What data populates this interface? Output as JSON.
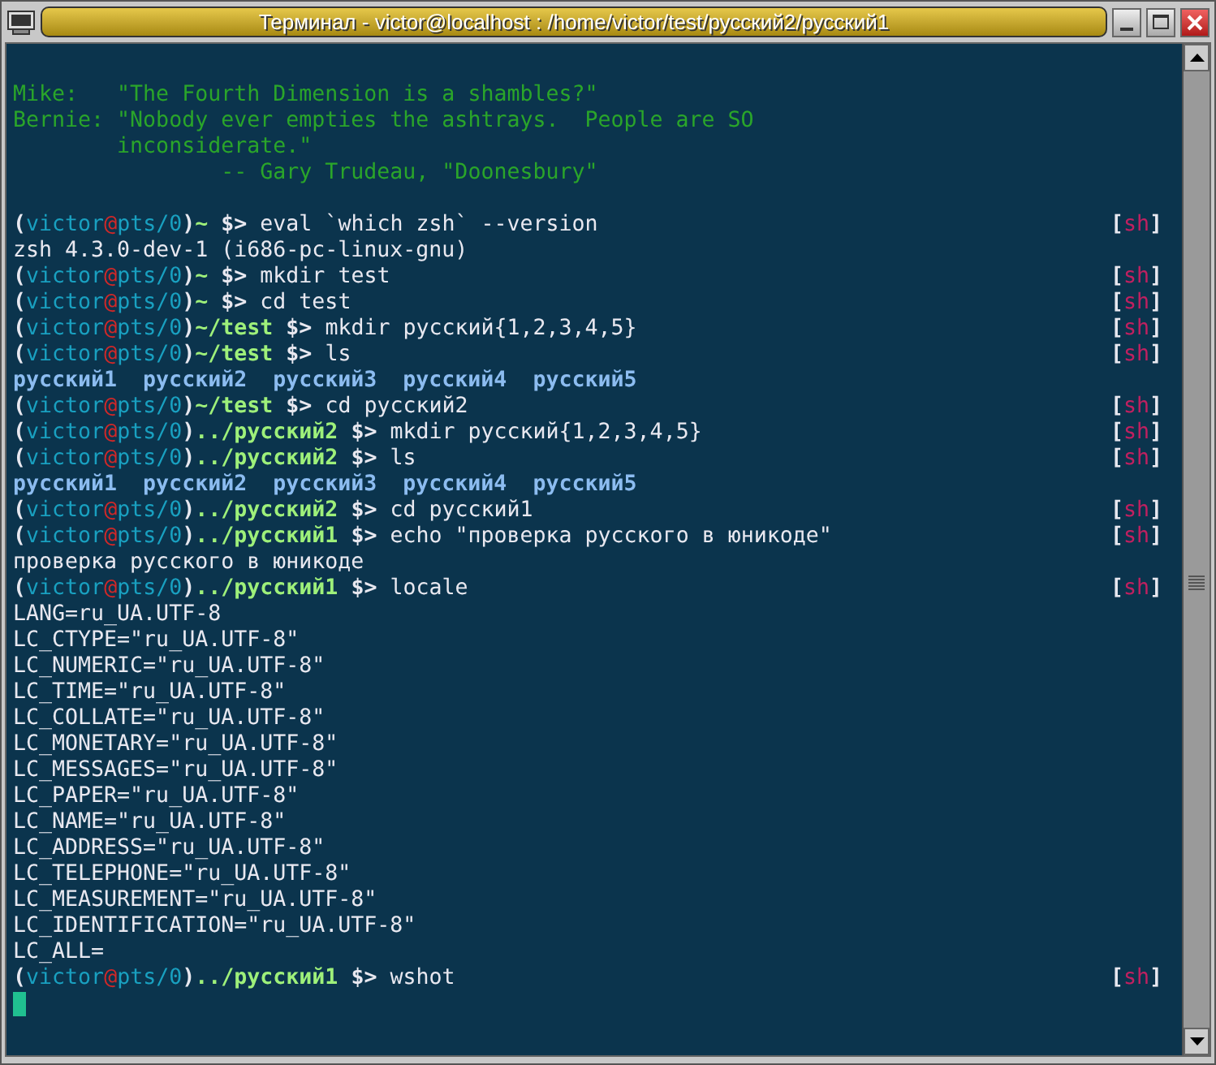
{
  "window": {
    "title": "Терминал - victor@localhost : /home/victor/test/русский2/русский1"
  },
  "lines": [
    {
      "kind": "blank"
    },
    {
      "kind": "quote",
      "text": "Mike:   \"The Fourth Dimension is a shambles?\""
    },
    {
      "kind": "quote",
      "text": "Bernie: \"Nobody ever empties the ashtrays.  People are SO"
    },
    {
      "kind": "quote",
      "text": "        inconsiderate.\""
    },
    {
      "kind": "quote",
      "text": "                -- Gary Trudeau, \"Doonesbury\""
    },
    {
      "kind": "blank"
    },
    {
      "kind": "prompt",
      "open": "(",
      "user": "victor",
      "at": "@",
      "tty": "pts/0",
      "close": ")",
      "path": "~",
      "sigil": "$>",
      "command": "eval `which zsh` --version",
      "tag": {
        "open": "[",
        "name": "sh",
        "close": "]"
      }
    },
    {
      "kind": "output",
      "text": "zsh 4.3.0-dev-1 (i686-pc-linux-gnu)"
    },
    {
      "kind": "prompt",
      "open": "(",
      "user": "victor",
      "at": "@",
      "tty": "pts/0",
      "close": ")",
      "path": "~",
      "sigil": "$>",
      "command": "mkdir test",
      "tag": {
        "open": "[",
        "name": "sh",
        "close": "]"
      }
    },
    {
      "kind": "prompt",
      "open": "(",
      "user": "victor",
      "at": "@",
      "tty": "pts/0",
      "close": ")",
      "path": "~",
      "sigil": "$>",
      "command": "cd test",
      "tag": {
        "open": "[",
        "name": "sh",
        "close": "]"
      }
    },
    {
      "kind": "prompt",
      "open": "(",
      "user": "victor",
      "at": "@",
      "tty": "pts/0",
      "close": ")",
      "path": "~/test",
      "sigil": "$>",
      "command": "mkdir русский{1,2,3,4,5}",
      "tag": {
        "open": "[",
        "name": "sh",
        "close": "]"
      }
    },
    {
      "kind": "prompt",
      "open": "(",
      "user": "victor",
      "at": "@",
      "tty": "pts/0",
      "close": ")",
      "path": "~/test",
      "sigil": "$>",
      "command": "ls",
      "tag": {
        "open": "[",
        "name": "sh",
        "close": "]"
      }
    },
    {
      "kind": "listing",
      "items": [
        "русский1",
        "русский2",
        "русский3",
        "русский4",
        "русский5"
      ]
    },
    {
      "kind": "prompt",
      "open": "(",
      "user": "victor",
      "at": "@",
      "tty": "pts/0",
      "close": ")",
      "path": "~/test",
      "sigil": "$>",
      "command": "cd русский2",
      "tag": {
        "open": "[",
        "name": "sh",
        "close": "]"
      }
    },
    {
      "kind": "prompt",
      "open": "(",
      "user": "victor",
      "at": "@",
      "tty": "pts/0",
      "close": ")",
      "path": "../русский2",
      "sigil": "$>",
      "command": "mkdir русский{1,2,3,4,5}",
      "tag": {
        "open": "[",
        "name": "sh",
        "close": "]"
      }
    },
    {
      "kind": "prompt",
      "open": "(",
      "user": "victor",
      "at": "@",
      "tty": "pts/0",
      "close": ")",
      "path": "../русский2",
      "sigil": "$>",
      "command": "ls",
      "tag": {
        "open": "[",
        "name": "sh",
        "close": "]"
      }
    },
    {
      "kind": "listing",
      "items": [
        "русский1",
        "русский2",
        "русский3",
        "русский4",
        "русский5"
      ]
    },
    {
      "kind": "prompt",
      "open": "(",
      "user": "victor",
      "at": "@",
      "tty": "pts/0",
      "close": ")",
      "path": "../русский2",
      "sigil": "$>",
      "command": "cd русский1",
      "tag": {
        "open": "[",
        "name": "sh",
        "close": "]"
      }
    },
    {
      "kind": "prompt",
      "open": "(",
      "user": "victor",
      "at": "@",
      "tty": "pts/0",
      "close": ")",
      "path": "../русский1",
      "sigil": "$>",
      "command": "echo \"проверка русского в юникоде\"",
      "tag": {
        "open": "[",
        "name": "sh",
        "close": "]"
      }
    },
    {
      "kind": "output",
      "text": "проверка русского в юникоде"
    },
    {
      "kind": "prompt",
      "open": "(",
      "user": "victor",
      "at": "@",
      "tty": "pts/0",
      "close": ")",
      "path": "../русский1",
      "sigil": "$>",
      "command": "locale",
      "tag": {
        "open": "[",
        "name": "sh",
        "close": "]"
      }
    },
    {
      "kind": "output",
      "text": "LANG=ru_UA.UTF-8"
    },
    {
      "kind": "output",
      "text": "LC_CTYPE=\"ru_UA.UTF-8\""
    },
    {
      "kind": "output",
      "text": "LC_NUMERIC=\"ru_UA.UTF-8\""
    },
    {
      "kind": "output",
      "text": "LC_TIME=\"ru_UA.UTF-8\""
    },
    {
      "kind": "output",
      "text": "LC_COLLATE=\"ru_UA.UTF-8\""
    },
    {
      "kind": "output",
      "text": "LC_MONETARY=\"ru_UA.UTF-8\""
    },
    {
      "kind": "output",
      "text": "LC_MESSAGES=\"ru_UA.UTF-8\""
    },
    {
      "kind": "output",
      "text": "LC_PAPER=\"ru_UA.UTF-8\""
    },
    {
      "kind": "output",
      "text": "LC_NAME=\"ru_UA.UTF-8\""
    },
    {
      "kind": "output",
      "text": "LC_ADDRESS=\"ru_UA.UTF-8\""
    },
    {
      "kind": "output",
      "text": "LC_TELEPHONE=\"ru_UA.UTF-8\""
    },
    {
      "kind": "output",
      "text": "LC_MEASUREMENT=\"ru_UA.UTF-8\""
    },
    {
      "kind": "output",
      "text": "LC_IDENTIFICATION=\"ru_UA.UTF-8\""
    },
    {
      "kind": "output",
      "text": "LC_ALL="
    },
    {
      "kind": "prompt",
      "open": "(",
      "user": "victor",
      "at": "@",
      "tty": "pts/0",
      "close": ")",
      "path": "../русский1",
      "sigil": "$>",
      "command": "wshot",
      "tag": {
        "open": "[",
        "name": "sh",
        "close": "]"
      }
    },
    {
      "kind": "cursor"
    }
  ]
}
